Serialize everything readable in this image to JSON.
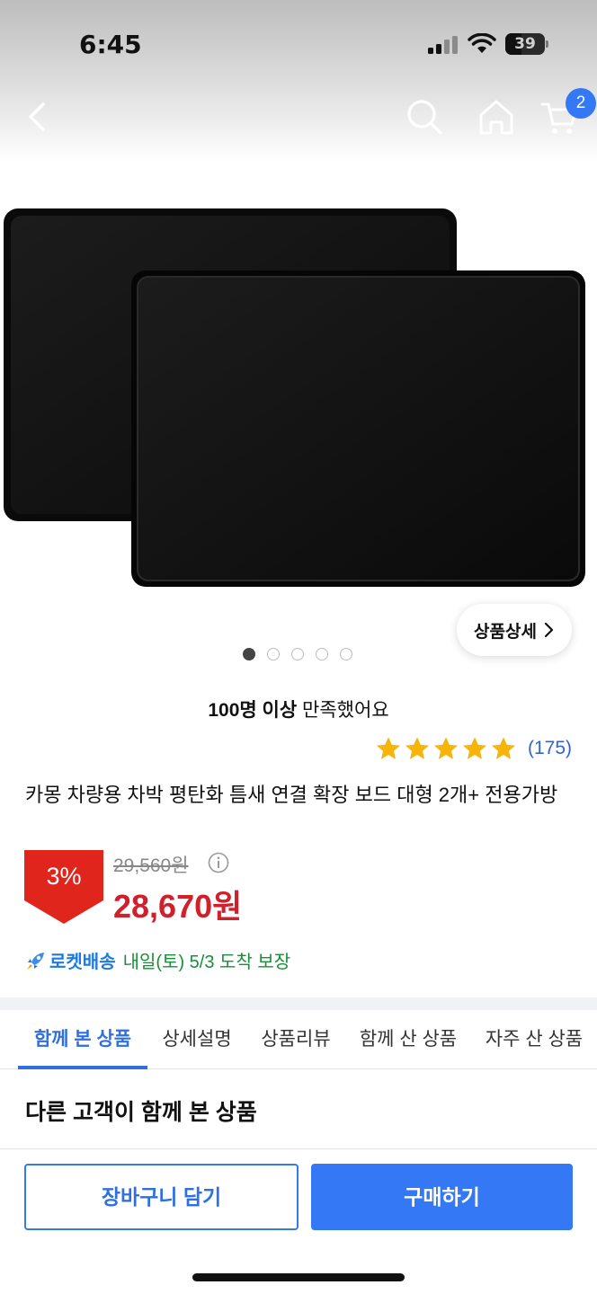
{
  "status_bar": {
    "time": "6:45",
    "battery": "39"
  },
  "nav": {
    "cart_count": "2",
    "icons": [
      "back-chevron",
      "search",
      "home",
      "cart"
    ]
  },
  "gallery": {
    "detail_button": "상품상세",
    "slide_count": 5,
    "active_slide": 1
  },
  "satisfaction": {
    "bold": "100명 이상",
    "rest": " 만족했어요"
  },
  "rating": {
    "stars": 5,
    "count": "(175)"
  },
  "product": {
    "title": "카몽 차량용 차박 평탄화 틈새 연결 확장 보드 대형 2개+ 전용가방",
    "discount": "3%",
    "original_price": "29,560원",
    "sale_price": "28,670원"
  },
  "delivery": {
    "label": "로켓배송",
    "text": "내일(토) 5/3 도착 보장"
  },
  "tabs": [
    {
      "label": "함께 본 상품",
      "active": true
    },
    {
      "label": "상세설명",
      "active": false
    },
    {
      "label": "상품리뷰",
      "active": false
    },
    {
      "label": "함께 산 상품",
      "active": false
    },
    {
      "label": "자주 산 상품",
      "active": false
    }
  ],
  "section": {
    "title": "다른 고객이 함께 본 상품"
  },
  "actions": {
    "cart_button": "장바구니 담기",
    "buy_button": "구매하기"
  },
  "colors": {
    "accent": "#3478f6",
    "price_red": "#d0202b",
    "star": "#f5b50a",
    "rocket_green": "#1a8f3a"
  }
}
